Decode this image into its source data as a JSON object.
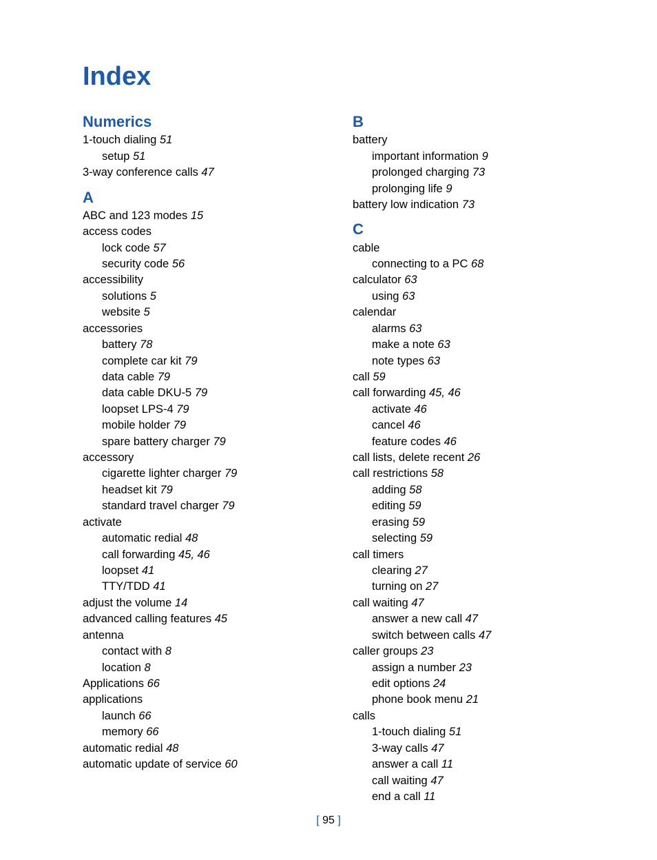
{
  "title": "Index",
  "pageNumber": "95",
  "columns": [
    {
      "sections": [
        {
          "head": "Numerics",
          "items": [
            {
              "text": "1-touch dialing",
              "page": "51"
            },
            {
              "text": "setup",
              "page": "51",
              "sub": true
            },
            {
              "text": "3-way conference calls",
              "page": "47"
            }
          ]
        },
        {
          "head": "A",
          "items": [
            {
              "text": "ABC and 123 modes",
              "page": "15"
            },
            {
              "text": "access codes"
            },
            {
              "text": "lock code",
              "page": "57",
              "sub": true
            },
            {
              "text": "security code",
              "page": "56",
              "sub": true
            },
            {
              "text": "accessibility"
            },
            {
              "text": "solutions",
              "page": "5",
              "sub": true
            },
            {
              "text": "website",
              "page": "5",
              "sub": true
            },
            {
              "text": "accessories"
            },
            {
              "text": "battery",
              "page": "78",
              "sub": true
            },
            {
              "text": "complete car kit",
              "page": "79",
              "sub": true
            },
            {
              "text": "data cable",
              "page": "79",
              "sub": true
            },
            {
              "text": "data cable DKU-5",
              "page": "79",
              "sub": true
            },
            {
              "text": "loopset LPS-4",
              "page": "79",
              "sub": true
            },
            {
              "text": "mobile holder",
              "page": "79",
              "sub": true
            },
            {
              "text": "spare battery charger",
              "page": "79",
              "sub": true
            },
            {
              "text": "accessory"
            },
            {
              "text": "cigarette lighter charger",
              "page": "79",
              "sub": true
            },
            {
              "text": "headset kit",
              "page": "79",
              "sub": true
            },
            {
              "text": "standard travel charger",
              "page": "79",
              "sub": true
            },
            {
              "text": "activate"
            },
            {
              "text": "automatic redial",
              "page": "48",
              "sub": true
            },
            {
              "text": "call forwarding",
              "page": "45, 46",
              "sub": true
            },
            {
              "text": "loopset",
              "page": "41",
              "sub": true
            },
            {
              "text": "TTY/TDD",
              "page": "41",
              "sub": true
            },
            {
              "text": "adjust the volume",
              "page": "14"
            },
            {
              "text": "advanced calling features",
              "page": "45"
            },
            {
              "text": "antenna"
            },
            {
              "text": "contact with",
              "page": "8",
              "sub": true
            },
            {
              "text": "location",
              "page": "8",
              "sub": true
            },
            {
              "text": "Applications",
              "page": "66"
            },
            {
              "text": "applications"
            },
            {
              "text": "launch",
              "page": "66",
              "sub": true
            },
            {
              "text": "memory",
              "page": "66",
              "sub": true
            },
            {
              "text": "automatic redial",
              "page": "48"
            },
            {
              "text": "automatic update of service",
              "page": "60"
            }
          ]
        }
      ]
    },
    {
      "sections": [
        {
          "head": "B",
          "items": [
            {
              "text": "battery"
            },
            {
              "text": "important information",
              "page": "9",
              "sub": true
            },
            {
              "text": "prolonged charging",
              "page": "73",
              "sub": true
            },
            {
              "text": "prolonging life",
              "page": "9",
              "sub": true
            },
            {
              "text": "battery low indication",
              "page": "73"
            }
          ]
        },
        {
          "head": "C",
          "items": [
            {
              "text": "cable"
            },
            {
              "text": "connecting to a PC",
              "page": "68",
              "sub": true
            },
            {
              "text": "calculator",
              "page": "63"
            },
            {
              "text": "using",
              "page": "63",
              "sub": true
            },
            {
              "text": "calendar"
            },
            {
              "text": "alarms",
              "page": "63",
              "sub": true
            },
            {
              "text": "make a note",
              "page": "63",
              "sub": true
            },
            {
              "text": "note types",
              "page": "63",
              "sub": true
            },
            {
              "text": "call",
              "page": "59"
            },
            {
              "text": "call forwarding",
              "page": "45, 46"
            },
            {
              "text": "activate",
              "page": "46",
              "sub": true
            },
            {
              "text": "cancel",
              "page": "46",
              "sub": true
            },
            {
              "text": "feature codes",
              "page": "46",
              "sub": true
            },
            {
              "text": "call lists, delete recent",
              "page": "26"
            },
            {
              "text": "call restrictions",
              "page": "58"
            },
            {
              "text": "adding",
              "page": "58",
              "sub": true
            },
            {
              "text": "editing",
              "page": "59",
              "sub": true
            },
            {
              "text": "erasing",
              "page": "59",
              "sub": true
            },
            {
              "text": "selecting",
              "page": "59",
              "sub": true
            },
            {
              "text": "call timers"
            },
            {
              "text": "clearing",
              "page": "27",
              "sub": true
            },
            {
              "text": "turning on",
              "page": "27",
              "sub": true
            },
            {
              "text": "call waiting",
              "page": "47"
            },
            {
              "text": "answer a new call",
              "page": "47",
              "sub": true
            },
            {
              "text": "switch between calls",
              "page": "47",
              "sub": true
            },
            {
              "text": "caller groups",
              "page": "23"
            },
            {
              "text": "assign a number",
              "page": "23",
              "sub": true
            },
            {
              "text": "edit options",
              "page": "24",
              "sub": true
            },
            {
              "text": "phone book menu",
              "page": "21",
              "sub": true
            },
            {
              "text": "calls"
            },
            {
              "text": "1-touch dialing",
              "page": "51",
              "sub": true
            },
            {
              "text": "3-way calls",
              "page": "47",
              "sub": true
            },
            {
              "text": "answer a call",
              "page": "11",
              "sub": true
            },
            {
              "text": "call waiting",
              "page": "47",
              "sub": true
            },
            {
              "text": "end a call",
              "page": "11",
              "sub": true
            }
          ]
        }
      ]
    }
  ]
}
